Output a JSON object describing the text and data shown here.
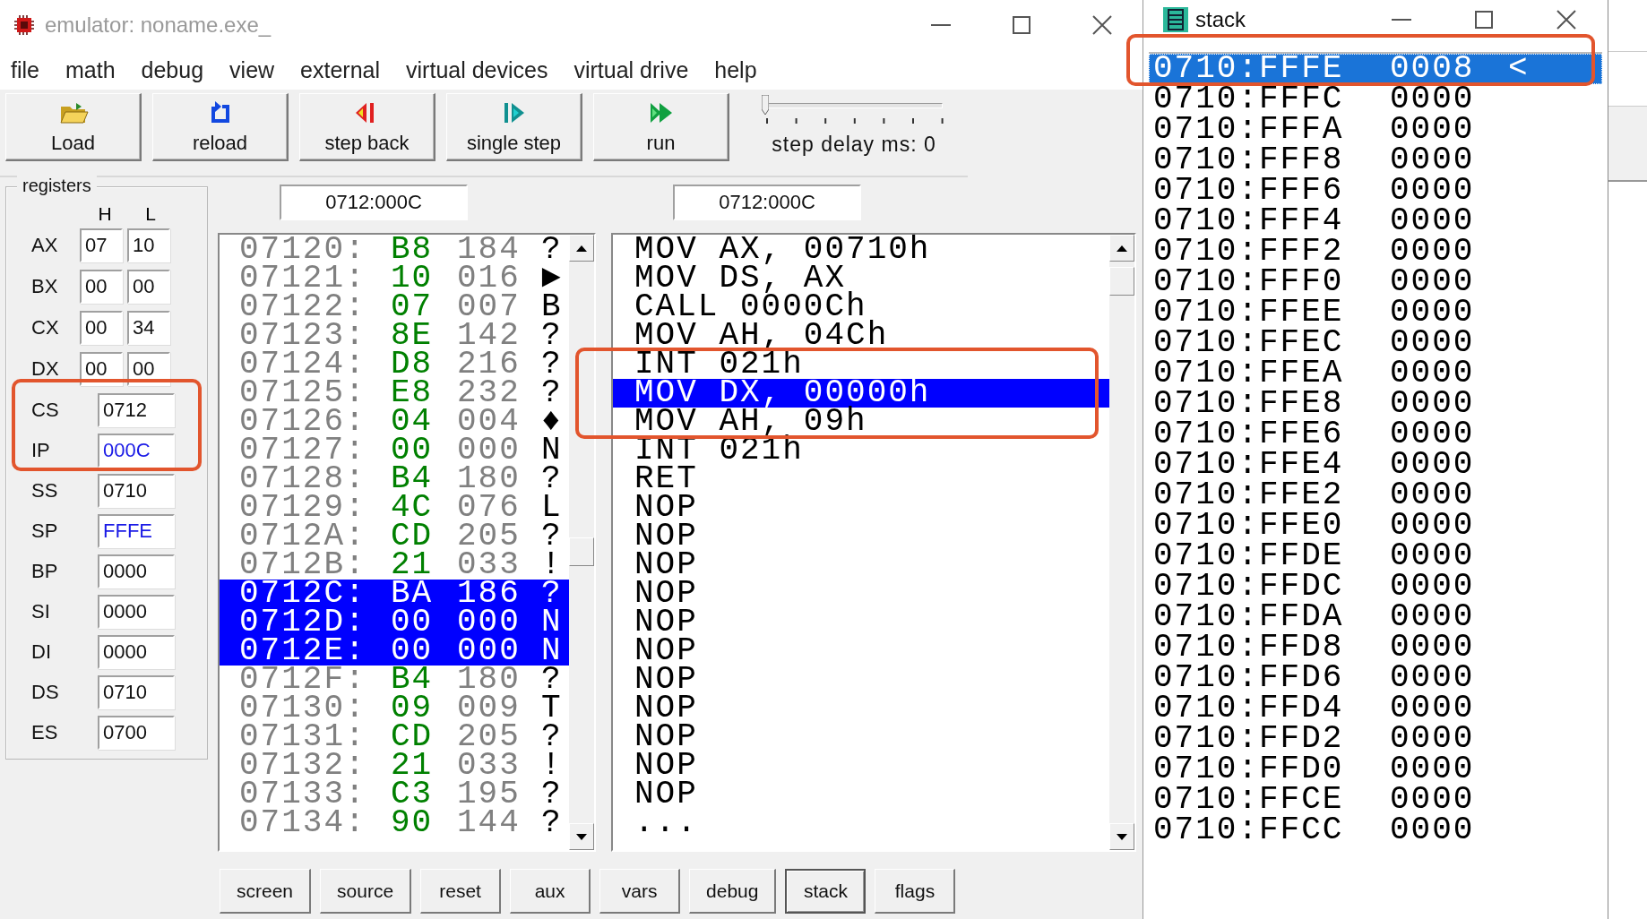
{
  "main_window": {
    "title": "emulator: noname.exe_",
    "menu": [
      "file",
      "math",
      "debug",
      "view",
      "external",
      "virtual devices",
      "virtual drive",
      "help"
    ],
    "toolbar": [
      {
        "label": "Load",
        "kind": "load"
      },
      {
        "label": "reload",
        "kind": "reload"
      },
      {
        "label": "step back",
        "kind": "back"
      },
      {
        "label": "single step",
        "kind": "step"
      },
      {
        "label": "run",
        "kind": "run"
      }
    ],
    "step_delay": {
      "label": "step delay ms: 0",
      "level": 0
    },
    "registers": {
      "title": "registers",
      "columns": [
        "H",
        "L"
      ],
      "general": [
        {
          "name": "AX",
          "high": "07",
          "low": "10"
        },
        {
          "name": "BX",
          "high": "00",
          "low": "00"
        },
        {
          "name": "CX",
          "high": "00",
          "low": "34"
        },
        {
          "name": "DX",
          "high": "00",
          "low": "00"
        }
      ],
      "segment": [
        {
          "name": "CS",
          "value": "0712",
          "changed": false,
          "outlined": true
        },
        {
          "name": "IP",
          "value": "000C",
          "changed": true,
          "outlined": true
        },
        {
          "name": "SS",
          "value": "0710",
          "changed": false,
          "outlined": false
        },
        {
          "name": "SP",
          "value": "FFFE",
          "changed": true,
          "outlined": false
        },
        {
          "name": "BP",
          "value": "0000",
          "changed": false,
          "outlined": false
        },
        {
          "name": "SI",
          "value": "0000",
          "changed": false,
          "outlined": false
        },
        {
          "name": "DI",
          "value": "0000",
          "changed": false,
          "outlined": false
        },
        {
          "name": "DS",
          "value": "0710",
          "changed": false,
          "outlined": false
        },
        {
          "name": "ES",
          "value": "0700",
          "changed": false,
          "outlined": false
        }
      ]
    },
    "memory": {
      "address": "0712:000C",
      "rows": [
        {
          "address": "07120:",
          "hex": "B8",
          "decimal": "184",
          "char": "?",
          "selected": false
        },
        {
          "address": "07121:",
          "hex": "10",
          "decimal": "016",
          "char": "►",
          "selected": false
        },
        {
          "address": "07122:",
          "hex": "07",
          "decimal": "007",
          "char": "B",
          "selected": false
        },
        {
          "address": "07123:",
          "hex": "8E",
          "decimal": "142",
          "char": "?",
          "selected": false
        },
        {
          "address": "07124:",
          "hex": "D8",
          "decimal": "216",
          "char": "?",
          "selected": false
        },
        {
          "address": "07125:",
          "hex": "E8",
          "decimal": "232",
          "char": "?",
          "selected": false
        },
        {
          "address": "07126:",
          "hex": "04",
          "decimal": "004",
          "char": "♦",
          "selected": false
        },
        {
          "address": "07127:",
          "hex": "00",
          "decimal": "000",
          "char": "N",
          "selected": false
        },
        {
          "address": "07128:",
          "hex": "B4",
          "decimal": "180",
          "char": "?",
          "selected": false
        },
        {
          "address": "07129:",
          "hex": "4C",
          "decimal": "076",
          "char": "L",
          "selected": false
        },
        {
          "address": "0712A:",
          "hex": "CD",
          "decimal": "205",
          "char": "?",
          "selected": false
        },
        {
          "address": "0712B:",
          "hex": "21",
          "decimal": "033",
          "char": "!",
          "selected": false
        },
        {
          "address": "0712C:",
          "hex": "BA",
          "decimal": "186",
          "char": "?",
          "selected": true
        },
        {
          "address": "0712D:",
          "hex": "00",
          "decimal": "000",
          "char": "N",
          "selected": true
        },
        {
          "address": "0712E:",
          "hex": "00",
          "decimal": "000",
          "char": "N",
          "selected": true
        },
        {
          "address": "0712F:",
          "hex": "B4",
          "decimal": "180",
          "char": "?",
          "selected": false
        },
        {
          "address": "07130:",
          "hex": "09",
          "decimal": "009",
          "char": "T",
          "selected": false
        },
        {
          "address": "07131:",
          "hex": "CD",
          "decimal": "205",
          "char": "?",
          "selected": false
        },
        {
          "address": "07132:",
          "hex": "21",
          "decimal": "033",
          "char": "!",
          "selected": false
        },
        {
          "address": "07133:",
          "hex": "C3",
          "decimal": "195",
          "char": "?",
          "selected": false
        },
        {
          "address": "07134:",
          "hex": "90",
          "decimal": "144",
          "char": "?",
          "selected": false
        }
      ]
    },
    "disassembly": {
      "address": "0712:000C",
      "rows": [
        {
          "text": "MOV AX, 00710h",
          "selected": false,
          "outlined": false
        },
        {
          "text": "MOV DS, AX",
          "selected": false,
          "outlined": false
        },
        {
          "text": "CALL 0000Ch",
          "selected": false,
          "outlined": false
        },
        {
          "text": "MOV AH, 04Ch",
          "selected": false,
          "outlined": false
        },
        {
          "text": "INT 021h",
          "selected": false,
          "outlined": true
        },
        {
          "text": "MOV DX, 00000h",
          "selected": true,
          "outlined": true
        },
        {
          "text": "MOV AH, 09h",
          "selected": false,
          "outlined": true
        },
        {
          "text": "INT 021h",
          "selected": false,
          "outlined": false
        },
        {
          "text": "RET",
          "selected": false,
          "outlined": false
        },
        {
          "text": "NOP",
          "selected": false,
          "outlined": false
        },
        {
          "text": "NOP",
          "selected": false,
          "outlined": false
        },
        {
          "text": "NOP",
          "selected": false,
          "outlined": false
        },
        {
          "text": "NOP",
          "selected": false,
          "outlined": false
        },
        {
          "text": "NOP",
          "selected": false,
          "outlined": false
        },
        {
          "text": "NOP",
          "selected": false,
          "outlined": false
        },
        {
          "text": "NOP",
          "selected": false,
          "outlined": false
        },
        {
          "text": "NOP",
          "selected": false,
          "outlined": false
        },
        {
          "text": "NOP",
          "selected": false,
          "outlined": false
        },
        {
          "text": "NOP",
          "selected": false,
          "outlined": false
        },
        {
          "text": "NOP",
          "selected": false,
          "outlined": false
        },
        {
          "text": "...",
          "selected": false,
          "outlined": false
        }
      ]
    },
    "bottom_buttons": [
      {
        "label": "screen",
        "selected": false
      },
      {
        "label": "source",
        "selected": false
      },
      {
        "label": "reset",
        "selected": false
      },
      {
        "label": "aux",
        "selected": false
      },
      {
        "label": "vars",
        "selected": false
      },
      {
        "label": "debug",
        "selected": false
      },
      {
        "label": "stack",
        "selected": true
      },
      {
        "label": "flags",
        "selected": false
      }
    ]
  },
  "stack_window": {
    "title": "stack",
    "rows": [
      {
        "address": "0710:FFFE",
        "value": "0008",
        "marker": "<",
        "selected": true,
        "outlined": true
      },
      {
        "address": "0710:FFFC",
        "value": "0000",
        "selected": false,
        "outlined": false
      },
      {
        "address": "0710:FFFA",
        "value": "0000",
        "selected": false,
        "outlined": false
      },
      {
        "address": "0710:FFF8",
        "value": "0000",
        "selected": false,
        "outlined": false
      },
      {
        "address": "0710:FFF6",
        "value": "0000",
        "selected": false,
        "outlined": false
      },
      {
        "address": "0710:FFF4",
        "value": "0000",
        "selected": false,
        "outlined": false
      },
      {
        "address": "0710:FFF2",
        "value": "0000",
        "selected": false,
        "outlined": false
      },
      {
        "address": "0710:FFF0",
        "value": "0000",
        "selected": false,
        "outlined": false
      },
      {
        "address": "0710:FFEE",
        "value": "0000",
        "selected": false,
        "outlined": false
      },
      {
        "address": "0710:FFEC",
        "value": "0000",
        "selected": false,
        "outlined": false
      },
      {
        "address": "0710:FFEA",
        "value": "0000",
        "selected": false,
        "outlined": false
      },
      {
        "address": "0710:FFE8",
        "value": "0000",
        "selected": false,
        "outlined": false
      },
      {
        "address": "0710:FFE6",
        "value": "0000",
        "selected": false,
        "outlined": false
      },
      {
        "address": "0710:FFE4",
        "value": "0000",
        "selected": false,
        "outlined": false
      },
      {
        "address": "0710:FFE2",
        "value": "0000",
        "selected": false,
        "outlined": false
      },
      {
        "address": "0710:FFE0",
        "value": "0000",
        "selected": false,
        "outlined": false
      },
      {
        "address": "0710:FFDE",
        "value": "0000",
        "selected": false,
        "outlined": false
      },
      {
        "address": "0710:FFDC",
        "value": "0000",
        "selected": false,
        "outlined": false
      },
      {
        "address": "0710:FFDA",
        "value": "0000",
        "selected": false,
        "outlined": false
      },
      {
        "address": "0710:FFD8",
        "value": "0000",
        "selected": false,
        "outlined": false
      },
      {
        "address": "0710:FFD6",
        "value": "0000",
        "selected": false,
        "outlined": false
      },
      {
        "address": "0710:FFD4",
        "value": "0000",
        "selected": false,
        "outlined": false
      },
      {
        "address": "0710:FFD2",
        "value": "0000",
        "selected": false,
        "outlined": false
      },
      {
        "address": "0710:FFD0",
        "value": "0000",
        "selected": false,
        "outlined": false
      },
      {
        "address": "0710:FFCE",
        "value": "0000",
        "selected": false,
        "outlined": false
      },
      {
        "address": "0710:FFCC",
        "value": "0000",
        "selected": false,
        "outlined": false
      }
    ]
  }
}
